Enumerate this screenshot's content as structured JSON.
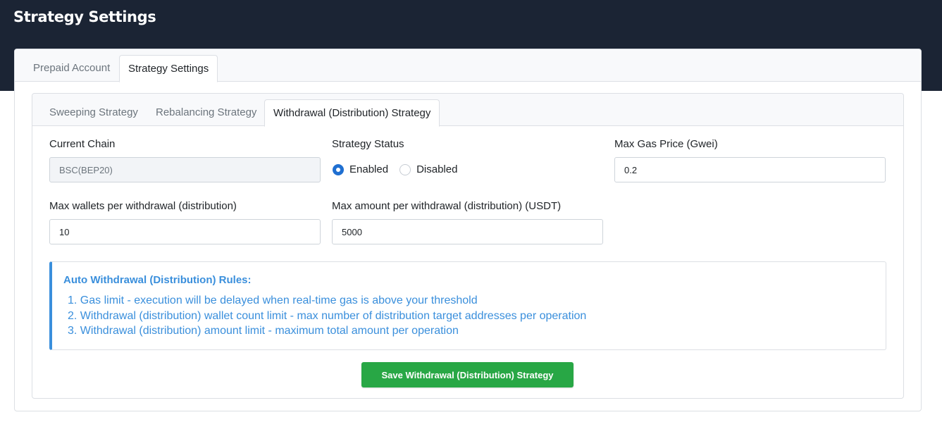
{
  "page": {
    "title": "Strategy Settings"
  },
  "outer_tabs": [
    {
      "label": "Prepaid Account",
      "active": false
    },
    {
      "label": "Strategy Settings",
      "active": true
    }
  ],
  "inner_tabs": [
    {
      "label": "Sweeping Strategy",
      "active": false
    },
    {
      "label": "Rebalancing Strategy",
      "active": false
    },
    {
      "label": "Withdrawal (Distribution) Strategy",
      "active": true
    }
  ],
  "form": {
    "current_chain": {
      "label": "Current Chain",
      "value": "BSC(BEP20)"
    },
    "strategy_status": {
      "label": "Strategy Status",
      "options": [
        "Enabled",
        "Disabled"
      ],
      "selected": "Enabled"
    },
    "max_gas_price": {
      "label": "Max Gas Price (Gwei)",
      "value": "0.2"
    },
    "max_wallets": {
      "label": "Max wallets per withdrawal (distribution)",
      "value": "10"
    },
    "max_amount": {
      "label": "Max amount per withdrawal (distribution) (USDT)",
      "value": "5000"
    }
  },
  "rules": {
    "title": "Auto Withdrawal (Distribution) Rules:",
    "items": [
      "1. Gas limit - execution will be delayed when real-time gas is above your threshold",
      "2. Withdrawal (distribution) wallet count limit - max number of distribution target addresses per operation",
      "3. Withdrawal (distribution) amount limit - maximum total amount per operation"
    ]
  },
  "actions": {
    "save_label": "Save Withdrawal (Distribution) Strategy"
  },
  "colors": {
    "header_bg": "#1b2434",
    "accent_blue": "#3a8fdc",
    "radio_blue": "#1f6fd1",
    "save_green": "#28a745"
  }
}
